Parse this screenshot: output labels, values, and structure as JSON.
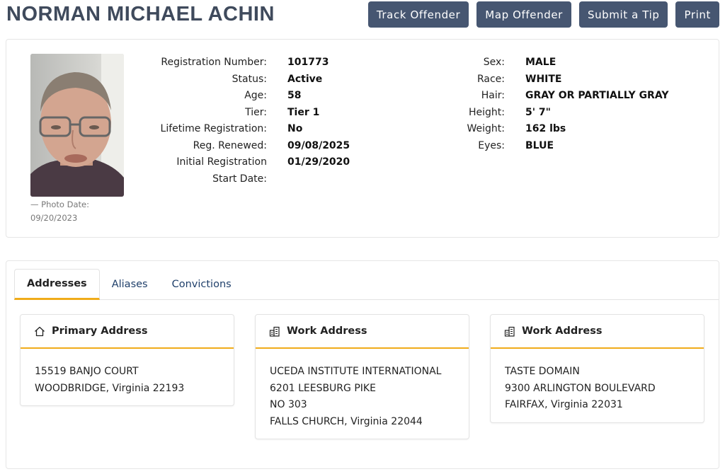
{
  "offender": {
    "name": "NORMAN MICHAEL ACHIN"
  },
  "actions": {
    "track": "Track Offender",
    "map": "Map Offender",
    "tip": "Submit a Tip",
    "print": "Print"
  },
  "photo": {
    "date_label": "— Photo Date:",
    "date": "09/20/2023"
  },
  "details_left": [
    {
      "label": "Registration Number:",
      "value": "101773"
    },
    {
      "label": "Status:",
      "value": "Active"
    },
    {
      "label": "Age:",
      "value": "58"
    },
    {
      "label": "Tier:",
      "value": "Tier 1"
    },
    {
      "label": "Lifetime Registration:",
      "value": "No"
    },
    {
      "label": "Reg. Renewed:",
      "value": "09/08/2025"
    },
    {
      "label": "Initial Registration",
      "value": "01/29/2020"
    },
    {
      "label": "Start Date:",
      "value": ""
    }
  ],
  "details_right": [
    {
      "label": "Sex:",
      "value": "MALE"
    },
    {
      "label": "Race:",
      "value": "WHITE"
    },
    {
      "label": "Hair:",
      "value": "GRAY OR PARTIALLY GRAY"
    },
    {
      "label": "Height:",
      "value": "5' 7\""
    },
    {
      "label": "Weight:",
      "value": "162 lbs"
    },
    {
      "label": "Eyes:",
      "value": "BLUE"
    }
  ],
  "tabs": [
    {
      "label": "Addresses",
      "active": true
    },
    {
      "label": "Aliases",
      "active": false
    },
    {
      "label": "Convictions",
      "active": false
    }
  ],
  "addresses": [
    {
      "title": "Primary Address",
      "icon": "home-icon",
      "lines": [
        "15519 BANJO COURT",
        "WOODBRIDGE, Virginia 22193"
      ]
    },
    {
      "title": "Work Address",
      "icon": "building-icon",
      "lines": [
        "UCEDA INSTITUTE INTERNATIONAL",
        "6201 LEESBURG PIKE",
        "NO 303",
        "FALLS CHURCH, Virginia 22044"
      ]
    },
    {
      "title": "Work Address",
      "icon": "building-icon",
      "lines": [
        "TASTE DOMAIN",
        "9300 ARLINGTON BOULEVARD",
        "FAIRFAX, Virginia 22031"
      ]
    }
  ],
  "colors": {
    "button_bg": "#465671",
    "accent": "#f0ac1a",
    "title": "#3f4a5c",
    "tab_link": "#20406b"
  }
}
